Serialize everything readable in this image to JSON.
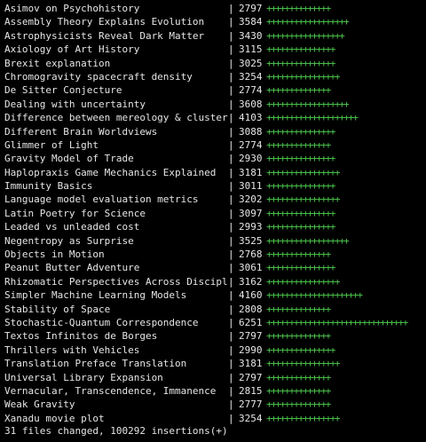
{
  "colors": {
    "background": "#000000",
    "text": "#e6e6e6",
    "insertions": "#4ec94e"
  },
  "separator": "|",
  "files": [
    {
      "name": "Asimov on Psychohistory",
      "count": "2797",
      "bar": "++++++++++++++"
    },
    {
      "name": "Assembly Theory Explains Evolution",
      "count": "3584",
      "bar": "++++++++++++++++++"
    },
    {
      "name": "Astrophysicists Reveal Dark Matter",
      "count": "3430",
      "bar": "+++++++++++++++++"
    },
    {
      "name": "Axiology of Art History",
      "count": "3115",
      "bar": "+++++++++++++++"
    },
    {
      "name": "Brexit explanation",
      "count": "3025",
      "bar": "+++++++++++++++"
    },
    {
      "name": "Chromogravity spacecraft density",
      "count": "3254",
      "bar": "++++++++++++++++"
    },
    {
      "name": "De Sitter Conjecture",
      "count": "2774",
      "bar": "++++++++++++++"
    },
    {
      "name": "Dealing with uncertainty",
      "count": "3608",
      "bar": "++++++++++++++++++"
    },
    {
      "name": "Difference between mereology & clustering",
      "count": "4103",
      "bar": "++++++++++++++++++++"
    },
    {
      "name": "Different Brain Worldviews",
      "count": "3088",
      "bar": "+++++++++++++++"
    },
    {
      "name": "Glimmer of Light",
      "count": "2774",
      "bar": "++++++++++++++"
    },
    {
      "name": "Gravity Model of Trade",
      "count": "2930",
      "bar": "+++++++++++++++"
    },
    {
      "name": "Haplopraxis Game Mechanics Explained",
      "count": "3181",
      "bar": "++++++++++++++++"
    },
    {
      "name": "Immunity Basics",
      "count": "3011",
      "bar": "+++++++++++++++"
    },
    {
      "name": "Language model evaluation metrics",
      "count": "3202",
      "bar": "++++++++++++++++"
    },
    {
      "name": "Latin Poetry for Science",
      "count": "3097",
      "bar": "+++++++++++++++"
    },
    {
      "name": "Leaded vs unleaded cost",
      "count": "2993",
      "bar": "+++++++++++++++"
    },
    {
      "name": "Negentropy as Surprise",
      "count": "3525",
      "bar": "++++++++++++++++++"
    },
    {
      "name": "Objects in Motion",
      "count": "2768",
      "bar": "++++++++++++++"
    },
    {
      "name": "Peanut Butter Adventure",
      "count": "3061",
      "bar": "+++++++++++++++"
    },
    {
      "name": "Rhizomatic Perspectives Across Disciplines",
      "count": "3162",
      "bar": "++++++++++++++++"
    },
    {
      "name": "Simpler Machine Learning Models",
      "count": "4160",
      "bar": "+++++++++++++++++++++"
    },
    {
      "name": "Stability of Space",
      "count": "2808",
      "bar": "++++++++++++++"
    },
    {
      "name": "Stochastic-Quantum Correspondence",
      "count": "6251",
      "bar": "+++++++++++++++++++++++++++++++"
    },
    {
      "name": "Textos Infinitos de Borges",
      "count": "2797",
      "bar": "++++++++++++++"
    },
    {
      "name": "Thrillers with Vehicles",
      "count": "2990",
      "bar": "+++++++++++++++"
    },
    {
      "name": "Translation Preface Translation",
      "count": "3181",
      "bar": "++++++++++++++++"
    },
    {
      "name": "Universal Library Expansion",
      "count": "2797",
      "bar": "++++++++++++++"
    },
    {
      "name": "Vernacular, Transcendence, Immanence",
      "count": "2815",
      "bar": "++++++++++++++"
    },
    {
      "name": "Weak Gravity",
      "count": "2777",
      "bar": "++++++++++++++"
    },
    {
      "name": "Xanadu movie plot",
      "count": "3254",
      "bar": "++++++++++++++++"
    }
  ],
  "summary": "31 files changed, 100292 insertions(+)"
}
